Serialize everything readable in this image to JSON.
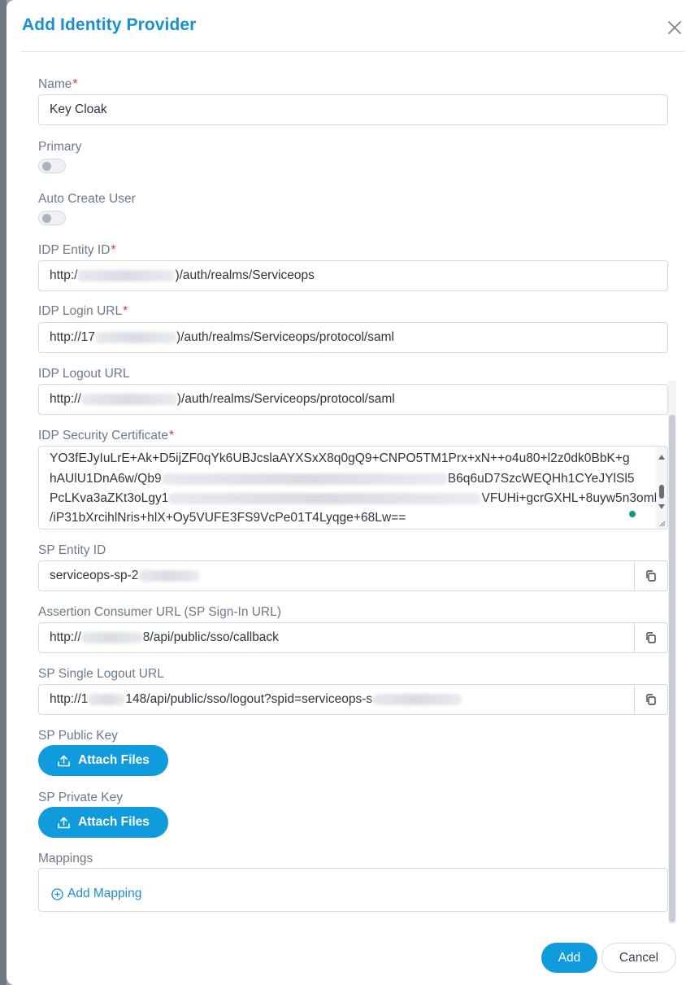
{
  "modal": {
    "title": "Add Identity Provider",
    "close_icon": "close-icon"
  },
  "fields": {
    "name": {
      "label": "Name",
      "required": "*",
      "value": "Key Cloak"
    },
    "primary": {
      "label": "Primary",
      "checked": false
    },
    "auto_create_user": {
      "label": "Auto Create User",
      "checked": false
    },
    "idp_entity_id": {
      "label": "IDP Entity ID",
      "required": "*",
      "value_prefix": "http:/",
      "value_suffix": ")/auth/realms/Serviceops"
    },
    "idp_login_url": {
      "label": "IDP Login URL",
      "required": "*",
      "value_prefix": "http://17",
      "value_suffix": ")/auth/realms/Serviceops/protocol/saml"
    },
    "idp_logout_url": {
      "label": "IDP Logout URL",
      "value_prefix": "http://",
      "value_suffix": ")/auth/realms/Serviceops/protocol/saml"
    },
    "idp_security_certificate": {
      "label": "IDP Security Certificate",
      "required": "*",
      "lines": [
        {
          "a": "YO3fEJyIuLrE+Ak+D5ijZF0qYk6UBJcslaAYXSxX8q0gQ9+CNPO5TM1Prx+xN++o4u80+l2z0dk0BbK+g",
          "b": ""
        },
        {
          "a": "hAUlU1DnA6w/Qb9",
          "b": "B6q6uD7SzcWEQHh1CYeJYlSl5"
        },
        {
          "a": "PcLKva3aZKt3oLgy1",
          "b": "VFUHi+gcrGXHL+8uyw5n3omk"
        },
        {
          "a": "/iP31bXrcihlNris+hlX+Oy5VUFE3FS9VcPe01T4Lyqge+68Lw==",
          "b": ""
        }
      ]
    },
    "sp_entity_id": {
      "label": "SP Entity ID",
      "value_prefix": "serviceops-sp-2",
      "value_suffix": ""
    },
    "assertion_consumer_url": {
      "label": "Assertion Consumer URL (SP Sign-In URL)",
      "value_prefix": "http://",
      "value_suffix": "8/api/public/sso/callback"
    },
    "sp_single_logout_url": {
      "label": "SP Single Logout URL",
      "value_prefix": "http://1",
      "value_suffix": "148/api/public/sso/logout?spid=serviceops-s"
    },
    "sp_public_key": {
      "label": "SP Public Key",
      "button_label": "Attach Files"
    },
    "sp_private_key": {
      "label": "SP Private Key",
      "button_label": "Attach Files"
    },
    "mappings": {
      "label": "Mappings",
      "add_label": "Add Mapping"
    }
  },
  "footer": {
    "add_label": "Add",
    "cancel_label": "Cancel"
  },
  "colors": {
    "accent": "#0f9bdc",
    "title": "#1a8fd1",
    "required": "#d9342b"
  }
}
